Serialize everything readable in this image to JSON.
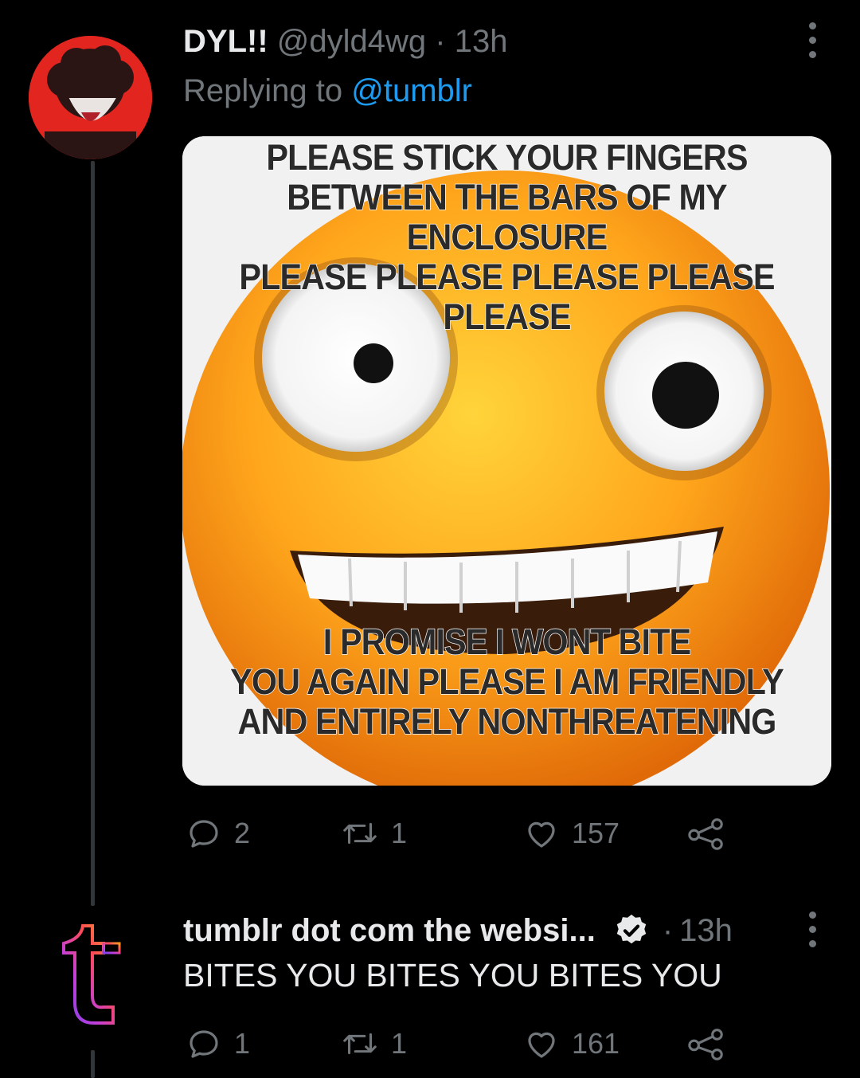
{
  "tweet1": {
    "display_name": "DYL!!",
    "handle": "@dyld4wg",
    "separator": "·",
    "time": "13h",
    "replying_prefix": "Replying to",
    "replying_handle": "@tumblr",
    "meme": {
      "top_lines": [
        "PLEASE STICK YOUR FINGERS",
        "BETWEEN THE BARS OF MY ENCLOSURE",
        "PLEASE PLEASE PLEASE PLEASE PLEASE"
      ],
      "bottom_lines": [
        "I PROMISE I WONT BITE",
        "YOU AGAIN PLEASE I AM FRIENDLY",
        "AND ENTIRELY NONTHREATENING"
      ]
    },
    "actions": {
      "replies": "2",
      "retweets": "1",
      "likes": "157"
    }
  },
  "tweet2": {
    "display_name": "tumblr dot com the websi...",
    "separator": "·",
    "time": "13h",
    "text": "BITES YOU BITES YOU BITES YOU",
    "actions": {
      "replies": "1",
      "retweets": "1",
      "likes": "161"
    }
  },
  "colors": {
    "background": "#000000",
    "text": "#e7e9ea",
    "muted": "#71767b",
    "link": "#1d9bf0",
    "avatar_bg": "#e2261f"
  }
}
